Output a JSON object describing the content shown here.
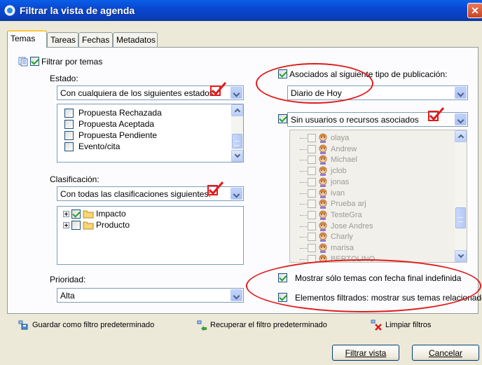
{
  "window": {
    "title": "Filtrar la vista de agenda",
    "close_glyph": "✕"
  },
  "tabs": [
    {
      "label": "Temas",
      "active": true
    },
    {
      "label": "Tareas"
    },
    {
      "label": "Fechas"
    },
    {
      "label": "Metadatos"
    }
  ],
  "left": {
    "filter_by_topics": "Filtrar por temas",
    "state_label": "Estado:",
    "state_combo": "Con cualquiera de los siguientes estados:",
    "states": [
      "Propuesta Rechazada",
      "Propuesta Aceptada",
      "Propuesta Pendiente",
      "Evento/cita"
    ],
    "class_label": "Clasificación:",
    "class_combo": "Con todas las clasificaciones siguientes:",
    "classifications": [
      {
        "label": "Impacto",
        "checked": true
      },
      {
        "label": "Producto",
        "checked": false
      }
    ],
    "priority_label": "Prioridad:",
    "priority_value": "Alta"
  },
  "right": {
    "pub_type_label": "Asociados al siguiente tipo de publicación:",
    "pub_type_value": "Diario de Hoy",
    "users_combo": "Sin usuarios o recursos asociados",
    "users": [
      "olaya",
      "Andrew",
      "Michael",
      "jclob",
      "jonas",
      "ivan",
      "Prueba arj",
      "TesteGra",
      "Jose Andres",
      "Charly",
      "marisa",
      "BERTOLINO"
    ],
    "only_indefinite": "Mostrar sólo temas con fecha final indefinida",
    "show_related": "Elementos filtrados: mostrar sus temas relacionados"
  },
  "footer": {
    "save_default": "Guardar como filtro predeterminado",
    "restore_default": "Recuperar el filtro predeterminado",
    "clear": "Limpiar filtros"
  },
  "buttons": {
    "apply": "Filtrar vista",
    "cancel": "Cancelar"
  },
  "colors": {
    "annotation": "#e01b1b",
    "title_bar": "#0a48d0",
    "panel": "#fcfcfe",
    "dialog": "#ece9d8"
  }
}
